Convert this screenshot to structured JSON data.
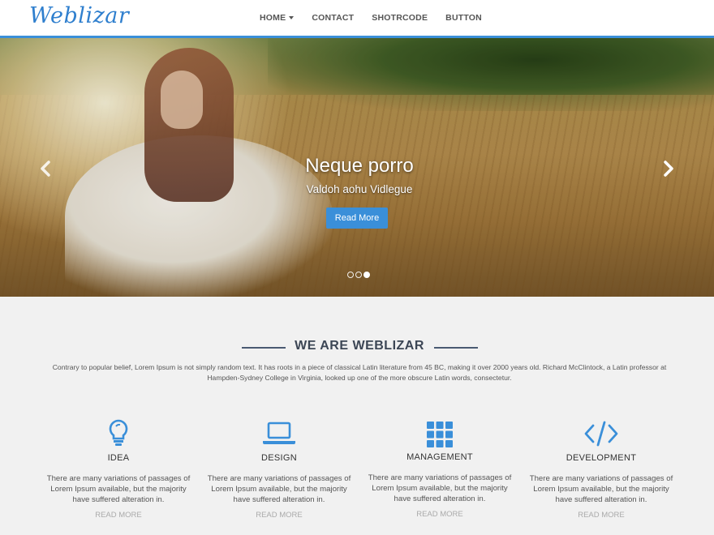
{
  "header": {
    "logo": "Weblizar",
    "nav": [
      {
        "label": "HOME"
      },
      {
        "label": "CONTACT"
      },
      {
        "label": "SHOTRCODE"
      },
      {
        "label": "BUTTON"
      }
    ]
  },
  "hero": {
    "title": "Neque porro",
    "subtitle": "Valdoh aohu Vidlegue",
    "button": "Read More",
    "slide_count": 3,
    "active_slide": 3
  },
  "about": {
    "title": "WE ARE WEBLIZAR",
    "description": "Contrary to popular belief, Lorem Ipsum is not simply random text. It has roots in a piece of classical Latin literature from 45 BC, making it over 2000 years old. Richard McClintock, a Latin professor at Hampden-Sydney College in Virginia, looked up one of the more obscure Latin words, consectetur."
  },
  "features": [
    {
      "icon": "lightbulb-icon",
      "title": "IDEA",
      "text": "There are many variations of passages of Lorem Ipsum available, but the majority have suffered alteration in.",
      "more": "READ MORE"
    },
    {
      "icon": "laptop-icon",
      "title": "DESIGN",
      "text": "There are many variations of passages of Lorem Ipsum available, but the majority have suffered alteration in.",
      "more": "READ MORE"
    },
    {
      "icon": "grid-icon",
      "title": "MANAGEMENT",
      "text": "There are many variations of passages of Lorem Ipsum available, but the majority have suffered alteration in.",
      "more": "READ MORE"
    },
    {
      "icon": "code-icon",
      "title": "DEVELOPMENT",
      "text": "There are many variations of passages of Lorem Ipsum available, but the majority have suffered alteration in.",
      "more": "READ MORE"
    }
  ],
  "colors": {
    "accent": "#3a8fd9",
    "section_bg": "#f1f1f1",
    "title_dark": "#3c4655"
  }
}
